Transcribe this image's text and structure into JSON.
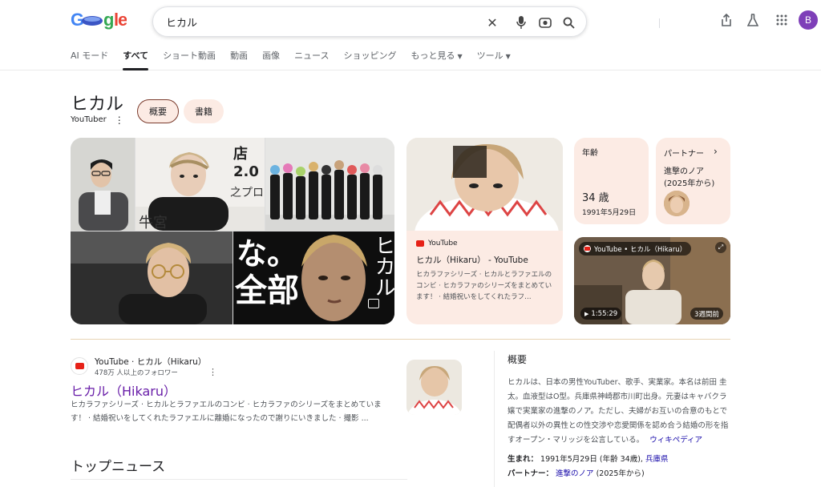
{
  "logo": {
    "text": "Google"
  },
  "search": {
    "query": "ヒカル"
  },
  "header": {
    "avatar_initial": "B"
  },
  "tabs": [
    {
      "label": "AI モード"
    },
    {
      "label": "すべて"
    },
    {
      "label": "ショート動画"
    },
    {
      "label": "動画"
    },
    {
      "label": "画像"
    },
    {
      "label": "ニュース"
    },
    {
      "label": "ショッピング"
    },
    {
      "label": "もっと見る"
    },
    {
      "label": "ツール"
    }
  ],
  "entity": {
    "title": "ヒカル",
    "subtitle": "YouTuber",
    "chips": [
      {
        "label": "概要"
      },
      {
        "label": "書籍"
      }
    ]
  },
  "collage": {
    "tile3_text_a": "な。",
    "tile3_text_b": "全部",
    "tile3_text_c": "ヒカル",
    "tile1_text": "店 2.0",
    "tile1_text_b": "之プロ",
    "tile1_text_c": "牛宮"
  },
  "yt_card": {
    "source": "YouTube",
    "title": "ヒカル（Hikaru） - YouTube",
    "desc": "ヒカラファシリーズ · ヒカルとラファエルのコンビ · ヒカラファのシリーズをまとめています！ · 結婚祝いをしてくれたラフ…"
  },
  "age_card": {
    "label": "年齢",
    "value": "34 歳",
    "date": "1991年5月29日"
  },
  "partner_card": {
    "label": "パートナー",
    "name": "進撃のノア",
    "note": "(2025年から)"
  },
  "video_card": {
    "channel": "YouTube • ヒカル（Hikaru）",
    "duration": "1:55:29",
    "ago": "3週間前"
  },
  "result": {
    "site": "YouTube · ヒカル（Hikaru）",
    "followers": "478万 人以上のフォロワー",
    "title": "ヒカル（Hikaru）",
    "snippet": "ヒカラファシリーズ · ヒカルとラファエルのコンビ · ヒカラファのシリーズをまとめています！ · 結婚祝いをしてくれたラファエルに離婚になったので謝りにいきました · 撮影 ..."
  },
  "top_news": {
    "title": "トップニュース"
  },
  "overview": {
    "heading": "概要",
    "text": "ヒカルは、日本の男性YouTuber、歌手、実業家。本名は前田 圭太。血液型はO型。兵庫県神崎郡市川町出身。元妻はキャバクラ嬢で実業家の進撃のノア。ただし、夫婦がお互いの合意のもとで配偶者以外の異性との性交渉や恋愛関係を認め合う結婚の形を指すオープン・マリッジを公言している。",
    "wiki": "ウィキペディア",
    "born_label": "生まれ：",
    "born_value": "1991年5月29日 (年齢 34歳),",
    "born_place": "兵庫県",
    "partner_label": "パートナー：",
    "partner_value": "進撃のノア",
    "partner_note": "(2025年から)"
  },
  "colors": {
    "accent_chip": "#fcebe4",
    "link": "#1a0dab",
    "visited": "#681da8",
    "avatar": "#7e3fb8"
  }
}
